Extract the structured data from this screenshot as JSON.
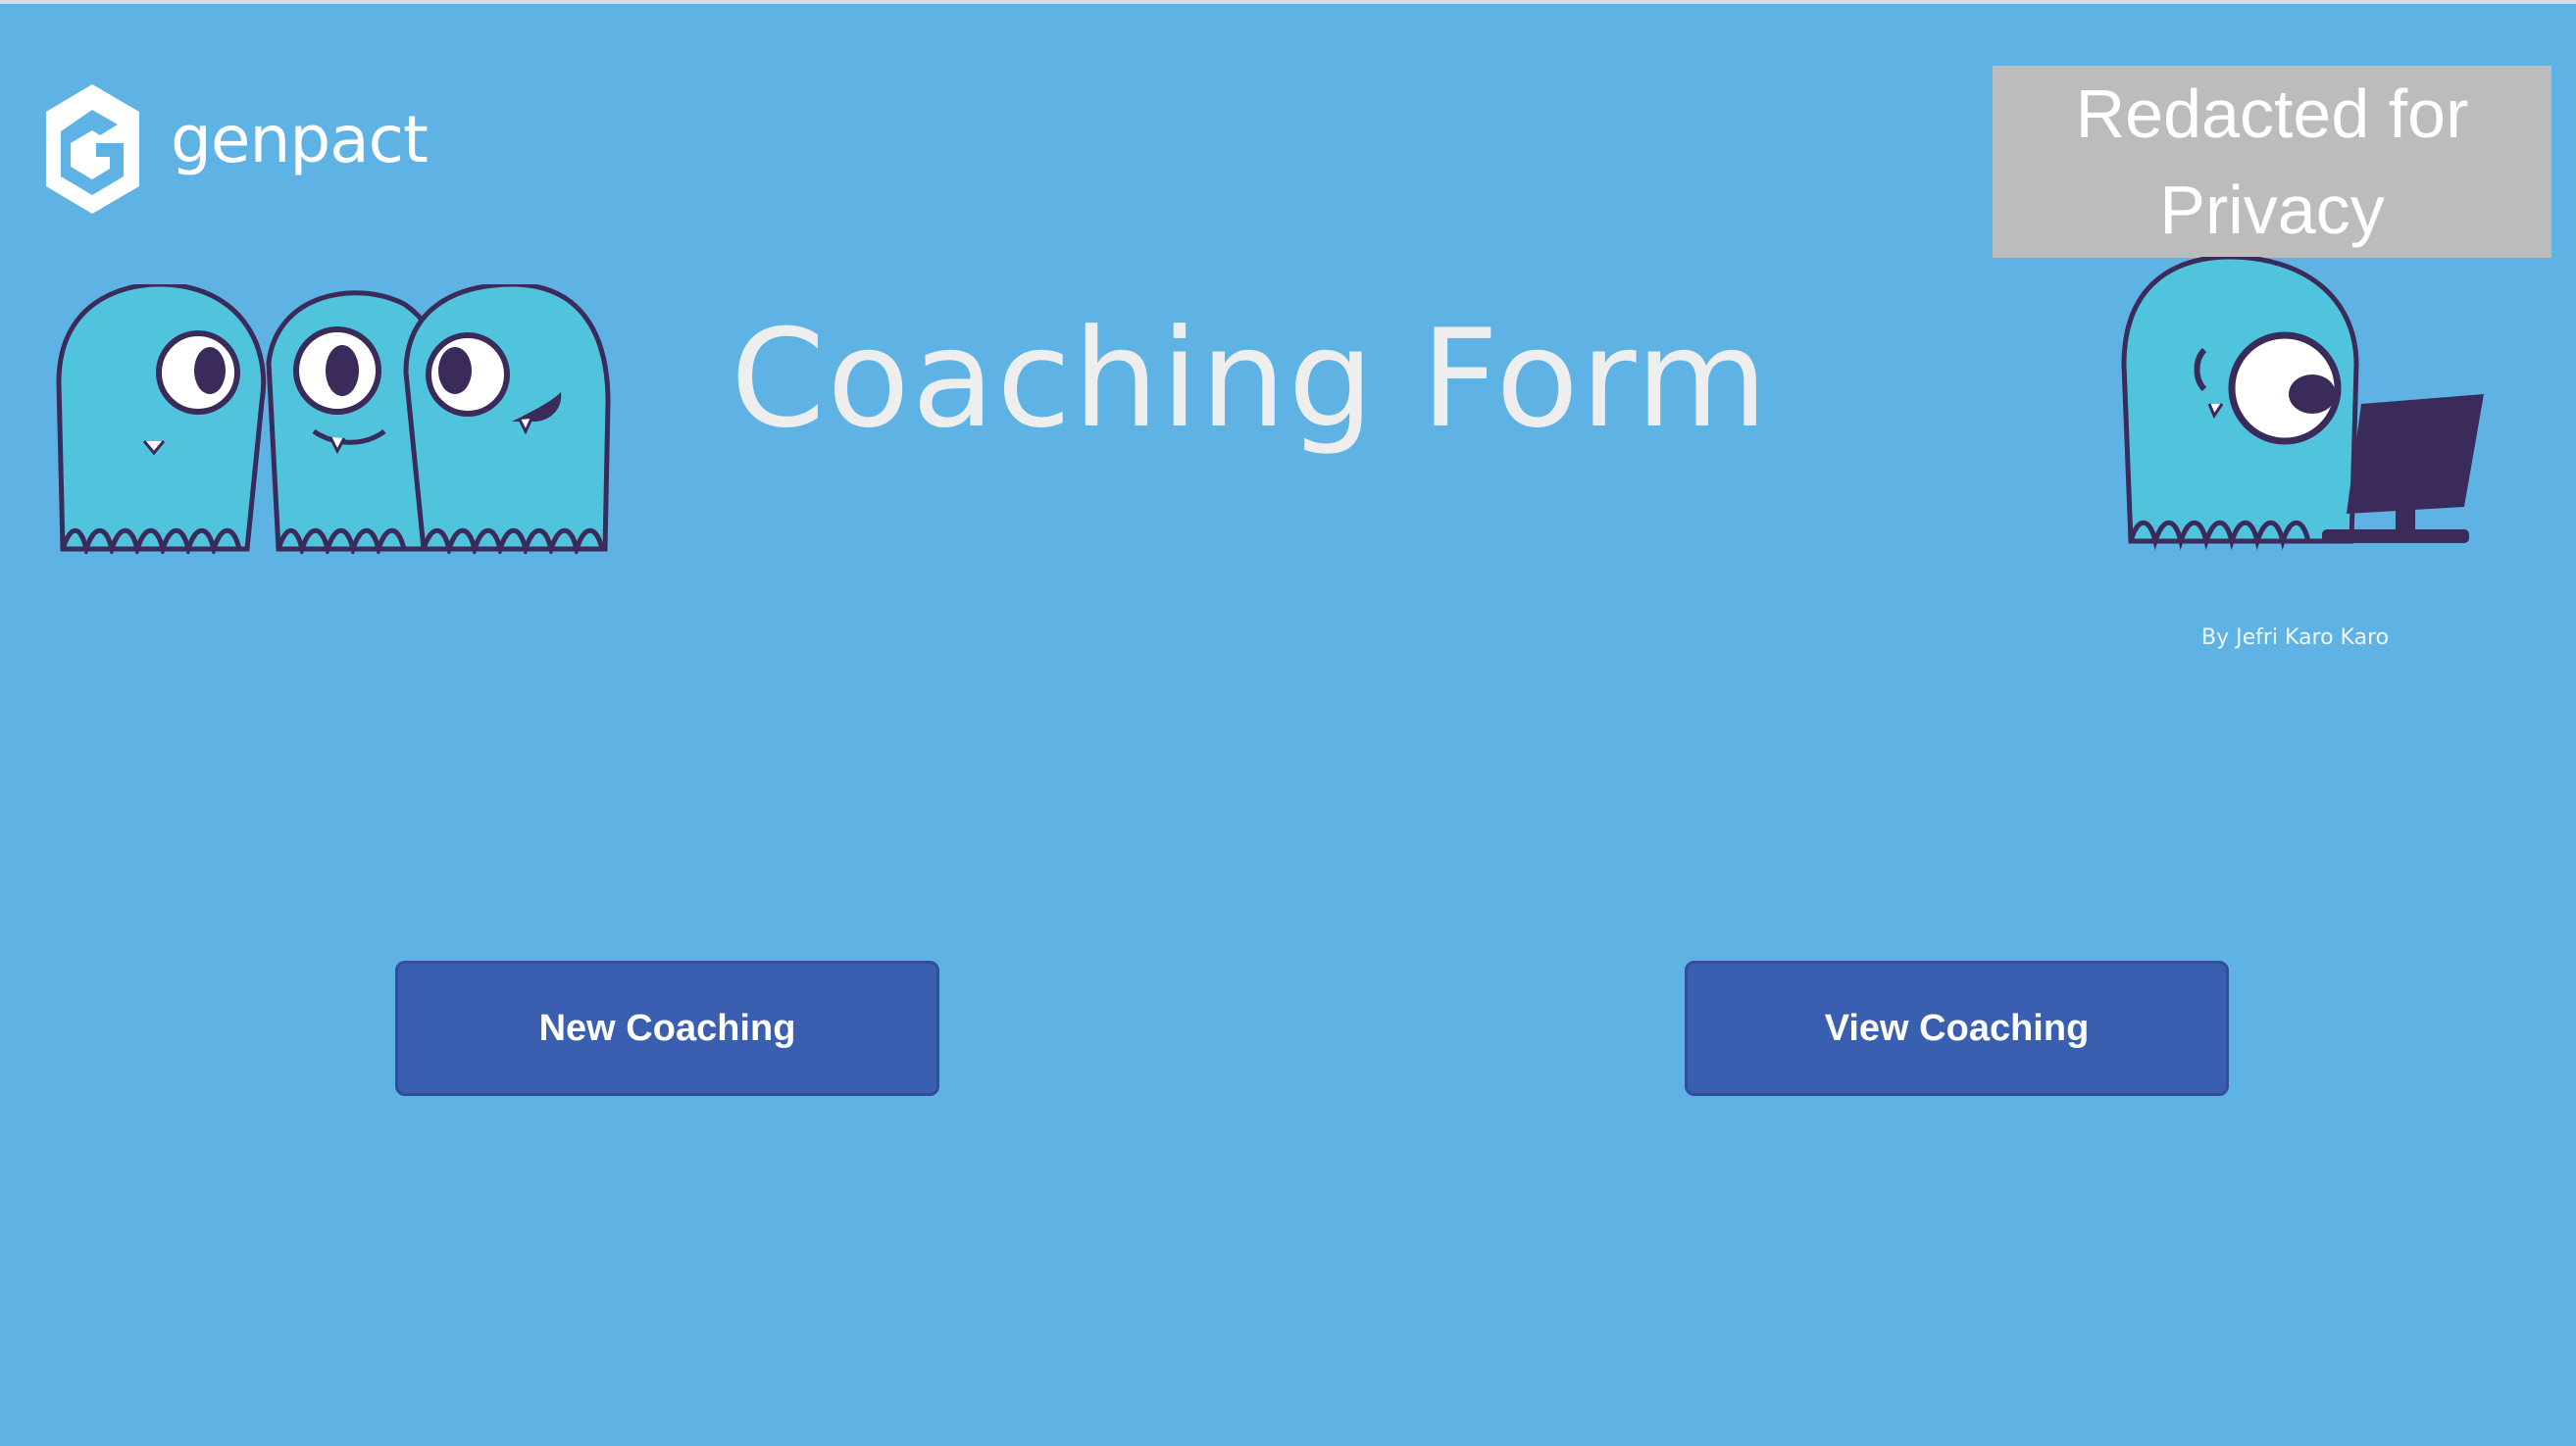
{
  "logo": {
    "text": "genpact",
    "icon": "genpact-logo-icon"
  },
  "redaction": {
    "text": "Redacted for Privacy"
  },
  "page": {
    "title": "Coaching Form",
    "byline": "By Jefri Karo Karo"
  },
  "buttons": {
    "new": "New Coaching",
    "view": "View Coaching"
  },
  "colors": {
    "background": "#5fb3e4",
    "button": "#3a5fb0",
    "monster": "#4fc4dc",
    "outline": "#3a2b5a",
    "redaction": "#bcbcbc"
  }
}
